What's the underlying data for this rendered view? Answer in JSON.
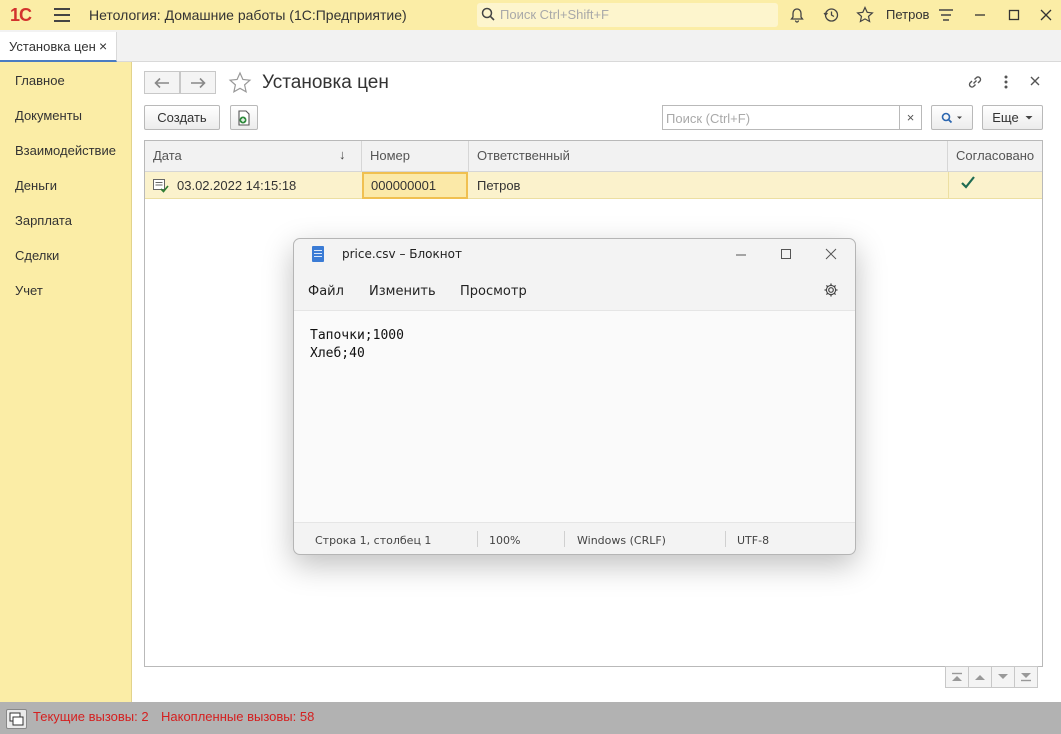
{
  "titlebar": {
    "logo": "1С",
    "app_title": "Нетология: Домашние работы  (1С:Предприятие)",
    "search_placeholder": "Поиск Ctrl+Shift+F",
    "user": "Петров"
  },
  "tabs": [
    {
      "label": "Установка цен",
      "close": "×"
    }
  ],
  "sidebar": {
    "items": [
      {
        "label": "Главное"
      },
      {
        "label": "Документы"
      },
      {
        "label": "Взаимодействие"
      },
      {
        "label": "Деньги"
      },
      {
        "label": "Зарплата"
      },
      {
        "label": "Сделки"
      },
      {
        "label": "Учет"
      }
    ]
  },
  "main": {
    "title": "Установка цен",
    "create_label": "Создать",
    "search_placeholder": "Поиск (Ctrl+F)",
    "search_clear": "×",
    "more_label": "Еще",
    "table": {
      "headers": {
        "date": "Дата",
        "number": "Номер",
        "responsible": "Ответственный",
        "approved": "Согласовано"
      },
      "sort_indicator": "↓",
      "rows": [
        {
          "date": "03.02.2022 14:15:18",
          "number": "000000001",
          "responsible": "Петров",
          "approved": true
        }
      ]
    }
  },
  "statusbar": {
    "current_calls": "Текущие вызовы: 2",
    "accumulated_calls": "Накопленные вызовы: 58"
  },
  "notepad": {
    "title": "price.csv – Блокнот",
    "menu": [
      "Файл",
      "Изменить",
      "Просмотр"
    ],
    "content": "Тапочки;1000\nХлеб;40",
    "status": {
      "position": "Строка 1, столбец 1",
      "zoom": "100%",
      "line_endings": "Windows (CRLF)",
      "encoding": "UTF-8"
    }
  },
  "colors": {
    "accent_yellow": "#fbeda6",
    "status_red": "#d42020",
    "check_green": "#1e6b52"
  }
}
